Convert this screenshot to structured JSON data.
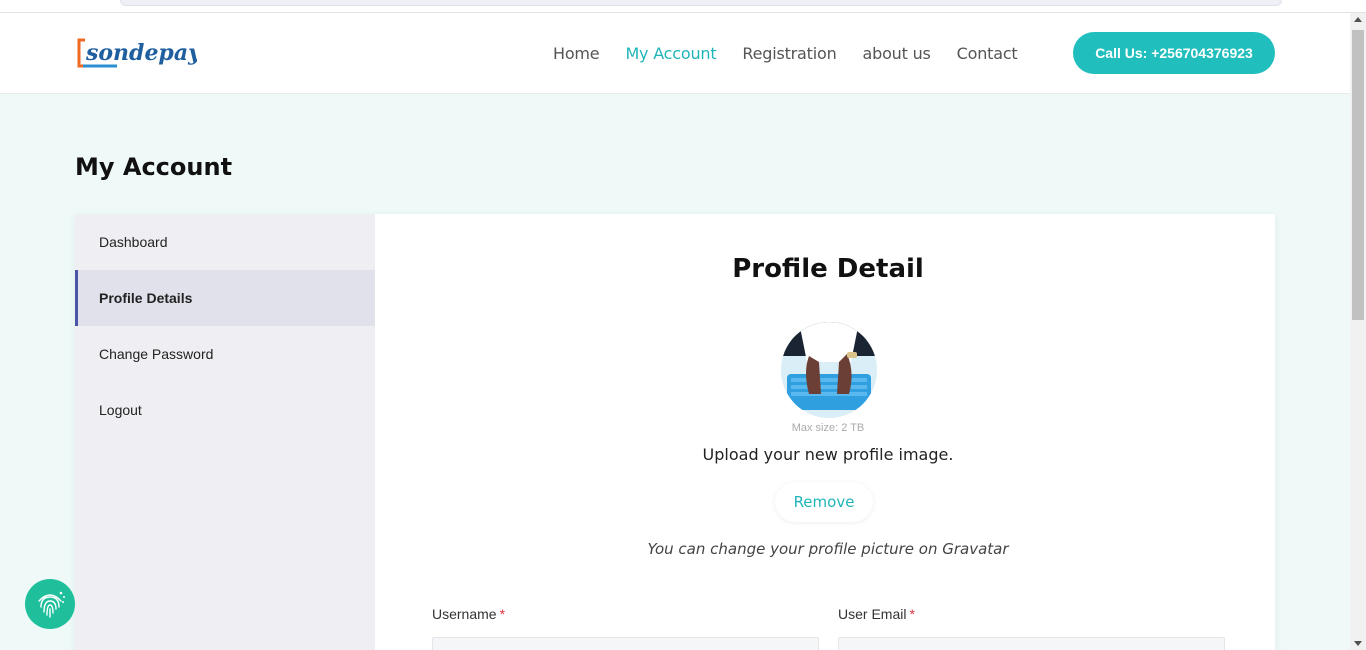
{
  "brand": {
    "logo_text": "sondepay"
  },
  "nav": {
    "items": [
      {
        "label": "Home",
        "active": false
      },
      {
        "label": "My Account",
        "active": true
      },
      {
        "label": "Registration",
        "active": false
      },
      {
        "label": "about us",
        "active": false
      },
      {
        "label": "Contact",
        "active": false
      }
    ],
    "call_label": "Call Us: +256704376923"
  },
  "page": {
    "title": "My Account"
  },
  "sidebar": {
    "items": [
      {
        "label": "Dashboard"
      },
      {
        "label": "Profile Details"
      },
      {
        "label": "Change Password"
      },
      {
        "label": "Logout"
      }
    ],
    "active_index": 1
  },
  "profile": {
    "title": "Profile Detail",
    "max_size": "Max size: 2 TB",
    "upload_text": "Upload your new profile image.",
    "remove_label": "Remove",
    "gravatar_text": "You can change your profile picture on Gravatar"
  },
  "form": {
    "username_label": "Username",
    "email_label": "User Email",
    "required_mark": "*",
    "username_value": "",
    "email_value": ""
  },
  "colors": {
    "accent": "#20b5b8",
    "button": "#20bfbd",
    "sidebar_active_border": "#4a55a8",
    "fab": "#1fbf9c"
  }
}
